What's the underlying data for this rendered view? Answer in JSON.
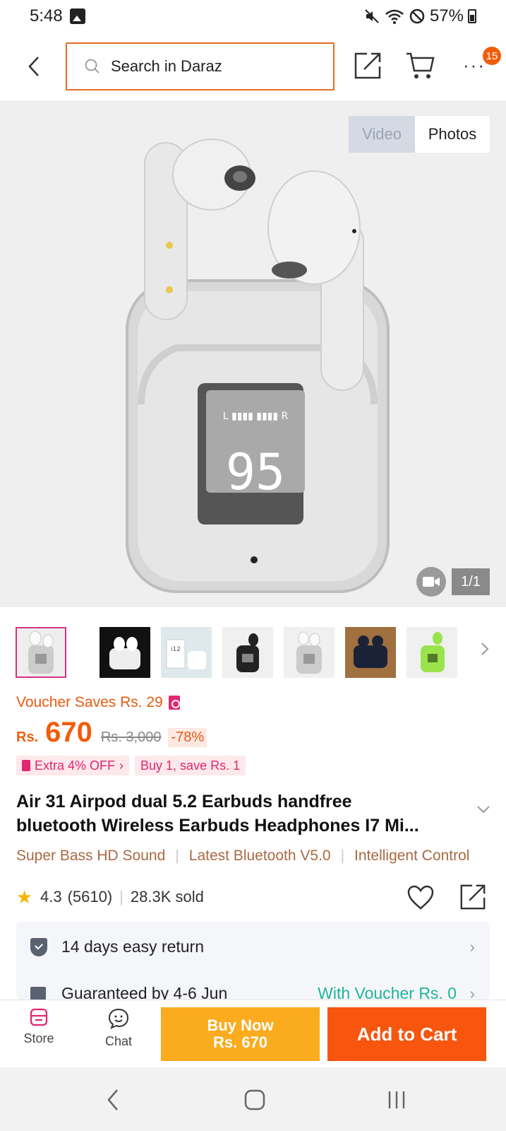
{
  "status_bar": {
    "time": "5:48",
    "battery": "57%",
    "icons": [
      "gallery-icon",
      "mute-icon",
      "wifi-icon",
      "dnd-icon",
      "battery-icon"
    ]
  },
  "header": {
    "search_placeholder": "Search in Daraz",
    "cart_badge": "15",
    "more_label": "···"
  },
  "media": {
    "tab_video": "Video",
    "tab_photos": "Photos",
    "counter": "1/1",
    "thumbnail_count": 7
  },
  "price": {
    "voucher_text": "Voucher Saves Rs. 29",
    "currency": "Rs.",
    "current": "670",
    "original": "Rs. 3,000",
    "discount": "-78%",
    "promos": [
      "Extra 4% OFF",
      "Buy 1, save Rs. 1"
    ]
  },
  "product": {
    "title_line1": "Air 31 Airpod dual 5.2 Earbuds handfree",
    "title_line2": "bluetooth Wireless Earbuds Headphones I7 Mi...",
    "features": [
      "Super Bass HD Sound",
      "Latest Bluetooth V5.0",
      "Intelligent Control"
    ],
    "rating": "4.3",
    "reviews": "(5610)",
    "sold": "28.3K sold"
  },
  "info": {
    "return_text": "14 days easy return",
    "delivery_text": "Guaranteed by 4-6 Jun",
    "delivery_voucher": "With Voucher Rs. 0"
  },
  "bottom_bar": {
    "store_label": "Store",
    "chat_label": "Chat",
    "buy_now_label": "Buy Now",
    "buy_now_price": "Rs. 670",
    "add_to_cart_label": "Add to Cart"
  },
  "colors": {
    "brand_orange": "#f8550e",
    "buy_now_yellow": "#fbab1e",
    "price_orange": "#f25c0a",
    "promo_pink": "#e22670",
    "feature_brown": "#a86a42"
  }
}
